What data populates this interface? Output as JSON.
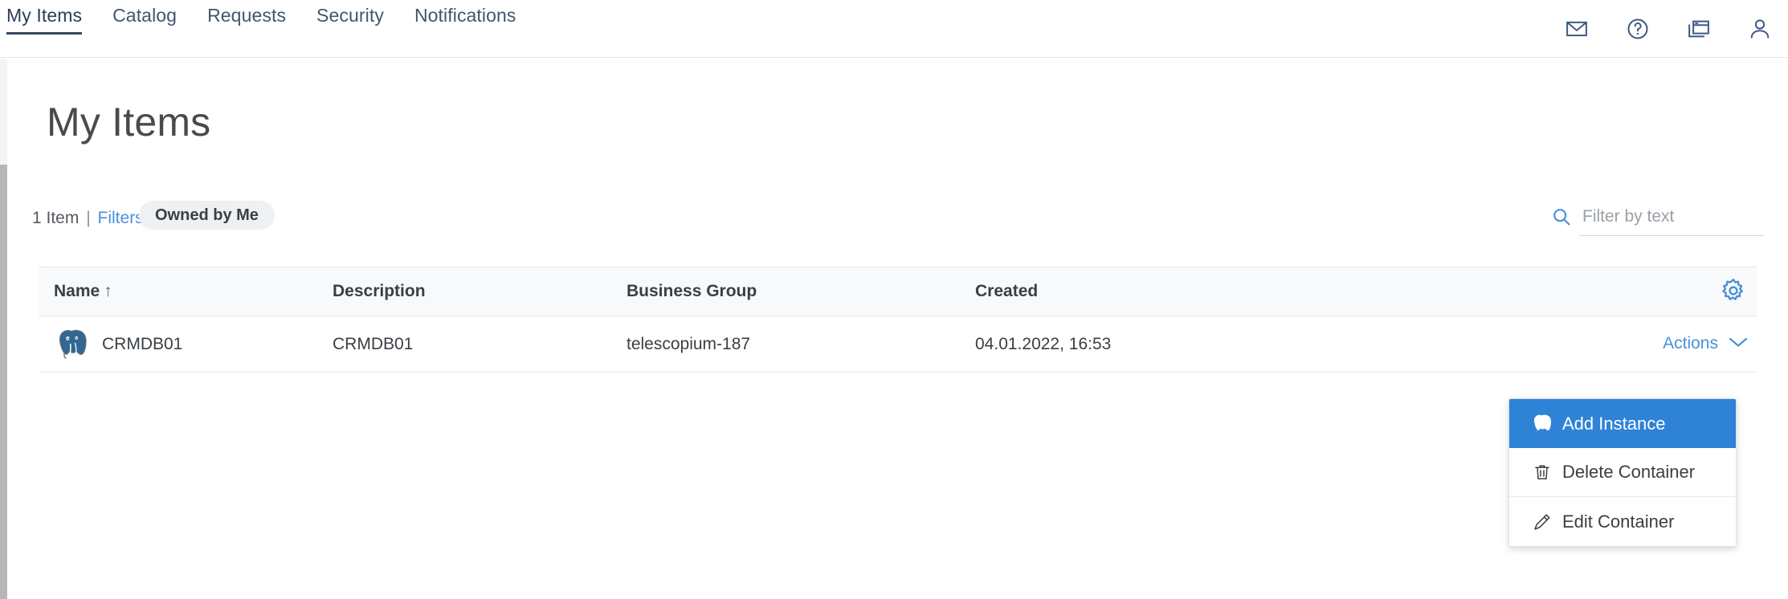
{
  "nav": {
    "tabs": [
      {
        "label": "My Items",
        "active": true
      },
      {
        "label": "Catalog",
        "active": false
      },
      {
        "label": "Requests",
        "active": false
      },
      {
        "label": "Security",
        "active": false
      },
      {
        "label": "Notifications",
        "active": false
      }
    ],
    "icons": [
      {
        "name": "mail-icon",
        "title": "Mail"
      },
      {
        "name": "help-icon",
        "title": "Help"
      },
      {
        "name": "windows-icon",
        "title": "Windows"
      },
      {
        "name": "user-icon",
        "title": "User"
      }
    ]
  },
  "page": {
    "title": "My Items"
  },
  "filterbar": {
    "item_count": "1 Item",
    "separator": "|",
    "filters_link": "Filters",
    "chip_label": "Owned by Me",
    "search_placeholder": "Filter by text",
    "search_value": "",
    "search_icon": "search-icon"
  },
  "table": {
    "columns": [
      {
        "label": "Name",
        "sort": "↑"
      },
      {
        "label": "Description",
        "sort": ""
      },
      {
        "label": "Business Group",
        "sort": ""
      },
      {
        "label": "Created",
        "sort": ""
      }
    ],
    "settings_icon": "gear-icon",
    "rows": [
      {
        "icon": "postgresql-elephant-icon",
        "name": "CRMDB01",
        "description": "CRMDB01",
        "business_group": "telescopium-187",
        "created": "04.01.2022, 16:53",
        "actions_label": "Actions"
      }
    ]
  },
  "dropdown": {
    "items": [
      {
        "label": "Add Instance",
        "icon": "postgresql-elephant-icon",
        "highlighted": true
      },
      {
        "label": "Delete Container",
        "icon": "trash-icon",
        "highlighted": false
      },
      {
        "label": "Edit Container",
        "icon": "pencil-icon",
        "highlighted": false
      }
    ]
  },
  "colors": {
    "link": "#4a90d9",
    "highlight": "#2e83d6",
    "active_tab_underline": "#34495e",
    "postgres_blue": "#336791",
    "header_bg": "#f8f9fa",
    "border": "#e3e6e8"
  }
}
